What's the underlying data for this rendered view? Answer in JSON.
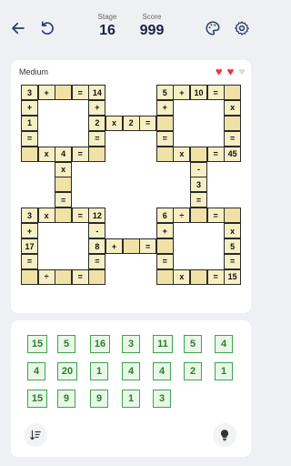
{
  "header": {
    "stage_label": "Stage",
    "stage_value": "16",
    "score_label": "Score",
    "score_value": "999"
  },
  "puzzle": {
    "difficulty": "Medium",
    "hearts": [
      {
        "state": "full",
        "color": "#e53935"
      },
      {
        "state": "full",
        "color": "#e53935"
      },
      {
        "state": "empty",
        "color": "#dddddd"
      }
    ],
    "cells": [
      [
        "3",
        "+",
        "",
        "=",
        "14",
        "",
        "",
        "",
        "5",
        "+",
        "10",
        "=",
        ""
      ],
      [
        "+",
        "",
        "",
        "",
        "+",
        "",
        "",
        "",
        "+",
        "",
        "",
        "",
        "x"
      ],
      [
        "1",
        "",
        "",
        "",
        "2",
        "x",
        "2",
        "=",
        "",
        "",
        "",
        "",
        ""
      ],
      [
        "=",
        "",
        "",
        "",
        "=",
        "",
        "",
        "",
        "=",
        "",
        "",
        "",
        "="
      ],
      [
        "",
        "x",
        "4",
        "=",
        "",
        "",
        "",
        "",
        "",
        "x",
        "",
        "=",
        "45"
      ],
      [
        "",
        "",
        "x",
        "",
        "",
        "",
        "",
        "",
        "",
        "",
        "-",
        "",
        ""
      ],
      [
        "",
        "",
        "",
        "",
        "",
        "",
        "",
        "",
        "",
        "",
        "3",
        "",
        ""
      ],
      [
        "",
        "",
        "=",
        "",
        "",
        "",
        "",
        "",
        "",
        "",
        "=",
        "",
        ""
      ],
      [
        "3",
        "x",
        "",
        "=",
        "12",
        "",
        "",
        "",
        "6",
        "÷",
        "",
        "=",
        ""
      ],
      [
        "+",
        "",
        "",
        "",
        "-",
        "",
        "",
        "",
        "+",
        "",
        "",
        "",
        "x"
      ],
      [
        "17",
        "",
        "",
        "",
        "8",
        "+",
        "",
        "=",
        "",
        "",
        "",
        "",
        "5"
      ],
      [
        "=",
        "",
        "",
        "",
        "=",
        "",
        "",
        "",
        "=",
        "",
        "",
        "",
        "="
      ],
      [
        "",
        "÷",
        "",
        "=",
        "",
        "",
        "",
        "",
        "",
        "x",
        "",
        "=",
        "15"
      ]
    ]
  },
  "tiles": [
    "15",
    "5",
    "16",
    "3",
    "11",
    "5",
    "4",
    "4",
    "20",
    "1",
    "4",
    "4",
    "2",
    "1",
    "15",
    "9",
    "9",
    "1",
    "3"
  ],
  "tools": {
    "sort_icon": "sort-icon",
    "hint_icon": "lightbulb-icon"
  }
}
